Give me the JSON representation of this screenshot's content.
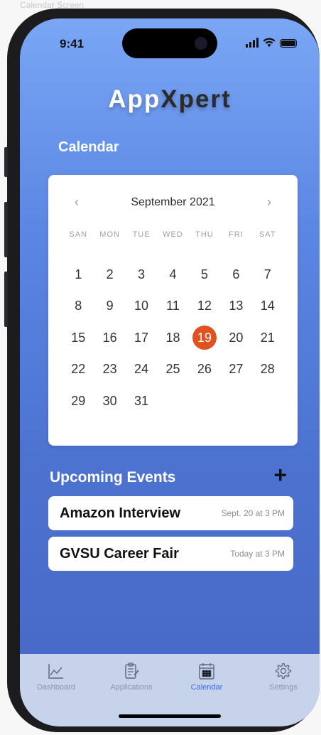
{
  "frame_label": "Calendar Screen",
  "status": {
    "time": "9:41"
  },
  "app": {
    "title_part1": "App",
    "title_part2": "Xpert"
  },
  "calendar": {
    "section_title": "Calendar",
    "month_label": "September 2021",
    "prev_icon": "chevron-left-icon",
    "next_icon": "chevron-right-icon",
    "weekdays": [
      "SAN",
      "MON",
      "TUE",
      "WED",
      "THU",
      "FRI",
      "SAT"
    ],
    "days": [
      "1",
      "2",
      "3",
      "4",
      "5",
      "6",
      "7",
      "8",
      "9",
      "10",
      "11",
      "12",
      "13",
      "14",
      "15",
      "16",
      "17",
      "18",
      "19",
      "20",
      "21",
      "22",
      "23",
      "24",
      "25",
      "26",
      "27",
      "28",
      "29",
      "30",
      "31"
    ],
    "selected_day": "19",
    "selected_color": "#e0521f"
  },
  "events": {
    "title": "Upcoming Events",
    "add_label": "+",
    "items": [
      {
        "name": "Amazon Interview",
        "time": "Sept. 20 at 3 PM"
      },
      {
        "name": "GVSU Career Fair",
        "time": "Today at 3 PM"
      }
    ]
  },
  "tabs": [
    {
      "label": "Dashboard",
      "icon": "chart-line-icon",
      "active": false
    },
    {
      "label": "Applications",
      "icon": "clipboard-icon",
      "active": false
    },
    {
      "label": "Calendar",
      "icon": "calendar-icon",
      "active": true
    },
    {
      "label": "Settings",
      "icon": "gear-icon",
      "active": false
    }
  ],
  "colors": {
    "accent": "#3d6ee8",
    "bg_top": "#7aa6f5",
    "bg_bottom": "#4766c4",
    "tabbar": "#c7d3ea"
  }
}
